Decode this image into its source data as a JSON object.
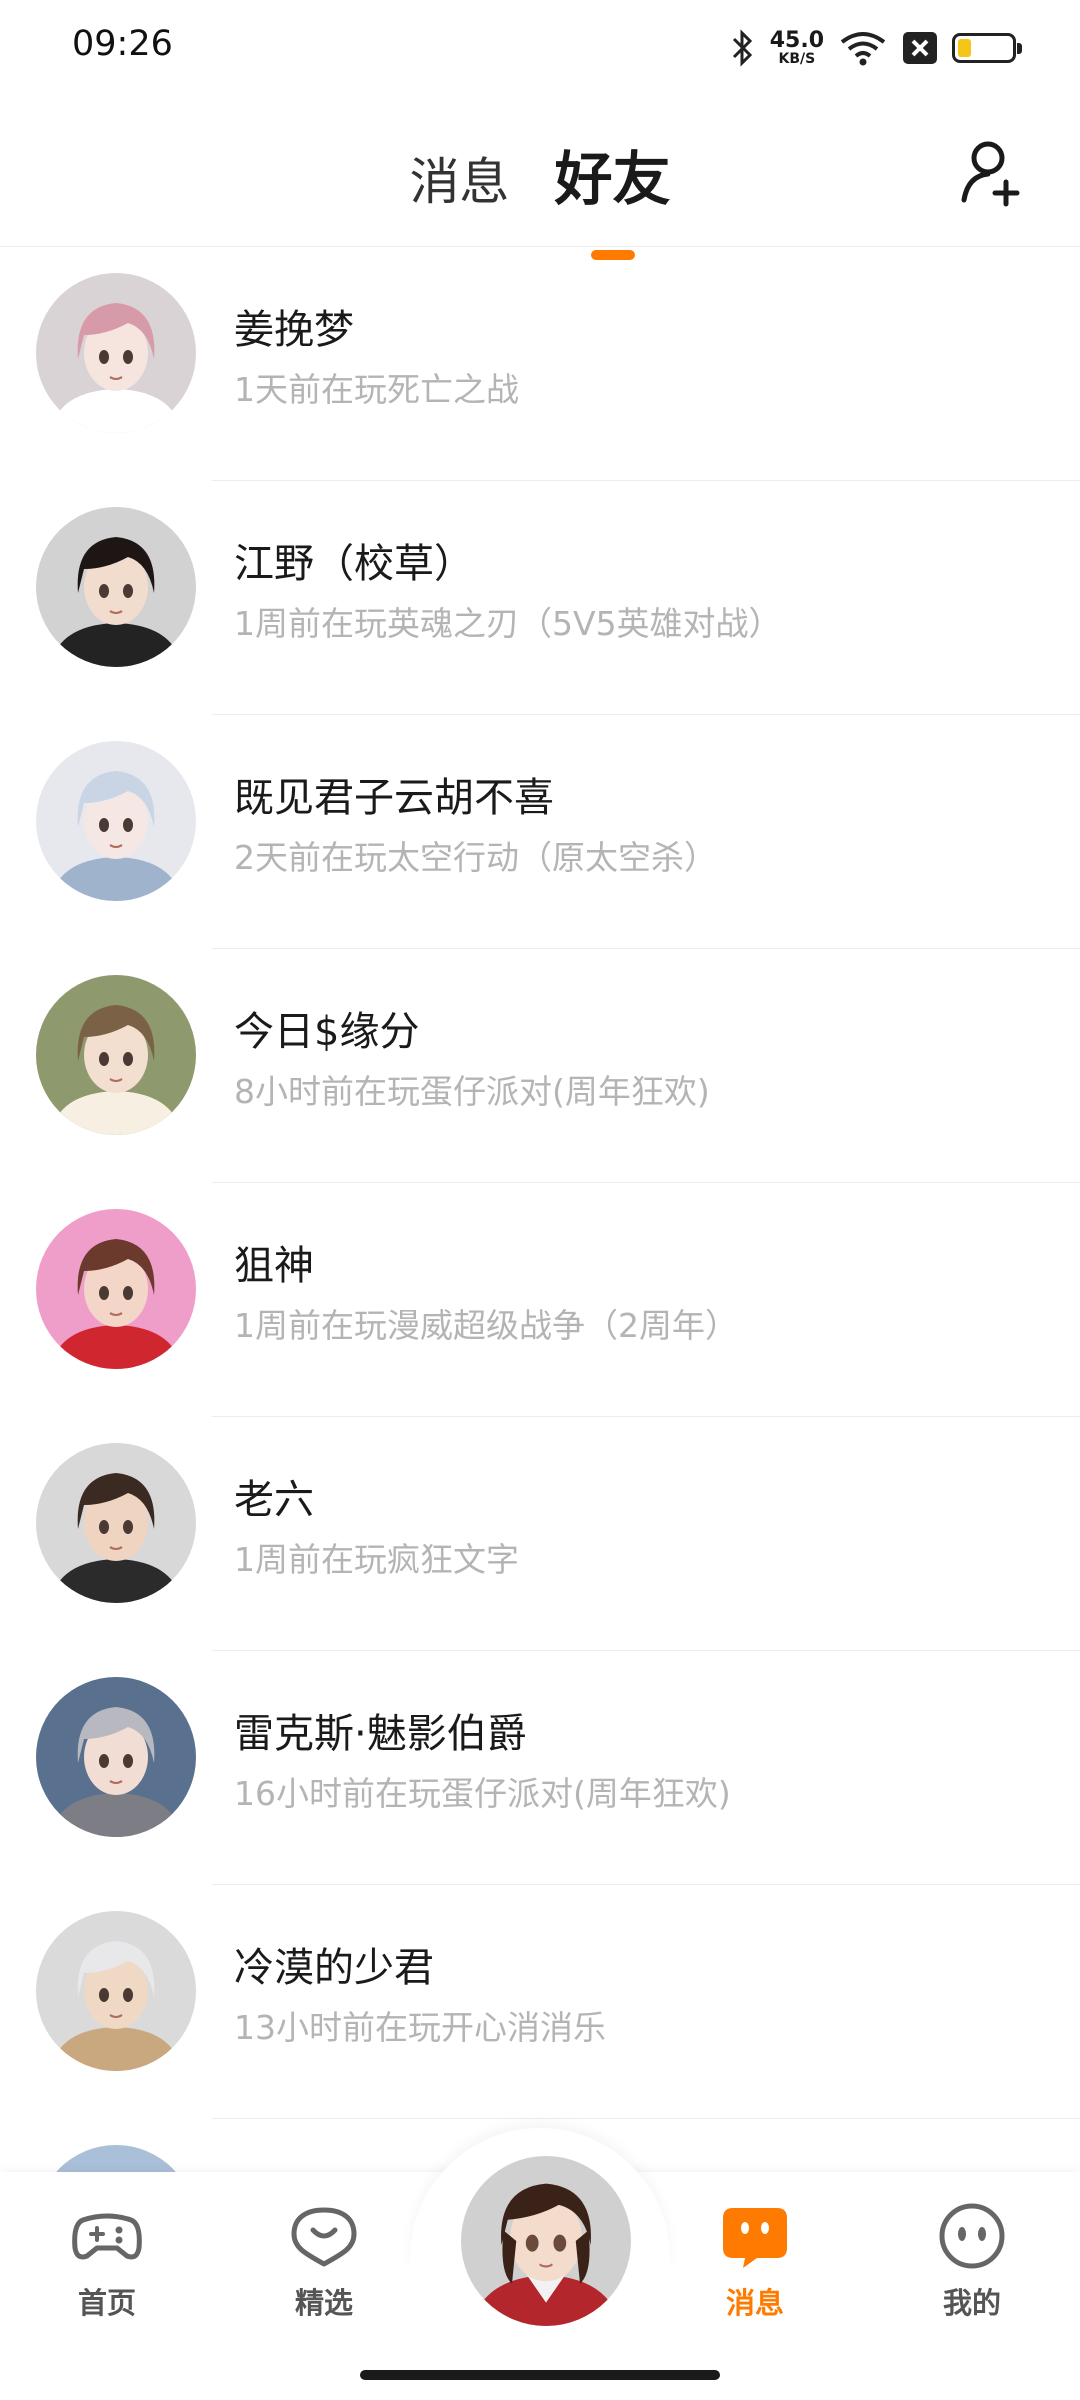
{
  "status_bar": {
    "time": "09:26",
    "net_speed": "45.0",
    "net_unit": "KB/S",
    "network": "4G",
    "battery_level": 0.25
  },
  "header": {
    "tabs": [
      {
        "label": "消息",
        "active": false
      },
      {
        "label": "好友",
        "active": true
      }
    ],
    "accent_color": "#ff7a00"
  },
  "friends": [
    {
      "name": "姜挽梦",
      "status": "1天前在玩死亡之战",
      "bg": "#d9d3d6",
      "hair": "#d79aa8",
      "skin": "#f6e4de",
      "cloth": "#ffffff"
    },
    {
      "name": "江野（校草）",
      "status": "1周前在玩英魂之刃（5V5英雄对战）",
      "bg": "#d2d2d2",
      "hair": "#1e1614",
      "skin": "#f1dccd",
      "cloth": "#232323"
    },
    {
      "name": "既见君子云胡不喜",
      "status": "2天前在玩太空行动（原太空杀）",
      "bg": "#e6e8ee",
      "hair": "#c9d4e4",
      "skin": "#f4e7e4",
      "cloth": "#9fb3cc"
    },
    {
      "name": "今日$缘分",
      "status": "8小时前在玩蛋仔派对(周年狂欢)",
      "bg": "#8e9a6d",
      "hair": "#7b6247",
      "skin": "#f3dfcf",
      "cloth": "#f6efe2"
    },
    {
      "name": "狙神",
      "status": "1周前在玩漫威超级战争（2周年）",
      "bg": "#ef9ec9",
      "hair": "#6b3a2c",
      "skin": "#f4d6c8",
      "cloth": "#d0262f"
    },
    {
      "name": "老六",
      "status": "1周前在玩疯狂文字",
      "bg": "#d8d8d8",
      "hair": "#3a2a22",
      "skin": "#efd4c2",
      "cloth": "#2b2b2b"
    },
    {
      "name": "雷克斯·魅影伯爵",
      "status": "16小时前在玩蛋仔派对(周年狂欢)",
      "bg": "#59708e",
      "hair": "#b8b8c0",
      "skin": "#f1ddd3",
      "cloth": "#7d7d86"
    },
    {
      "name": "冷漠的少君",
      "status": "13小时前在玩开心消消乐",
      "bg": "#dadada",
      "hair": "#e8e8ea",
      "skin": "#efd9c4",
      "cloth": "#c9a77f"
    }
  ],
  "bottom_nav": {
    "items": [
      {
        "label": "首页",
        "icon": "gamepad-icon"
      },
      {
        "label": "精选",
        "icon": "heart-bubble-icon"
      },
      {
        "label": "消息",
        "icon": "chat-bubble-icon",
        "active": true
      },
      {
        "label": "我的",
        "icon": "face-icon"
      }
    ]
  }
}
